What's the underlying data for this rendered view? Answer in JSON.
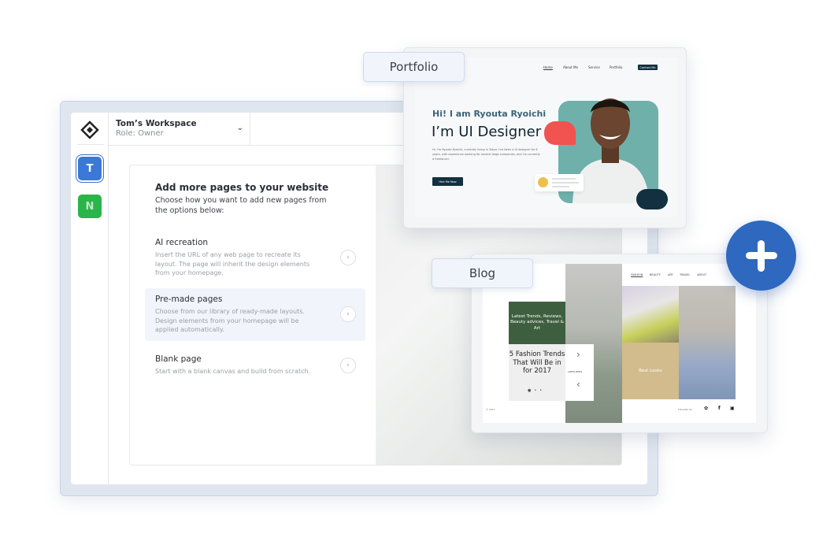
{
  "workspace": {
    "name": "Tom’s Workspace",
    "role": "Role: Owner",
    "avatars": [
      {
        "letter": "T",
        "color": "#3b78d8"
      },
      {
        "letter": "N",
        "color": "#2bb44a"
      }
    ]
  },
  "panel": {
    "title": "Add more pages to your website",
    "subtitle": "Choose how you want to add new pages from the options below:",
    "options": [
      {
        "title": "AI recreation",
        "description": "Insert the URL of any web page to recreate its layout. The page will inherit the design elements from your homepage.",
        "selected": false
      },
      {
        "title": "Pre-made pages",
        "description": "Choose from our library of ready-made layouts. Design elements from your homepage will be applied automatically.",
        "selected": true
      },
      {
        "title": "Blank page",
        "description": "Start with a blank canvas and build from scratch.",
        "selected": false
      }
    ]
  },
  "portfolio": {
    "tag": "Portfolio",
    "nav": [
      "Home",
      "About Me",
      "Service",
      "Portfolio"
    ],
    "contact": "Contact Me",
    "greeting": "Hi! I am Ryouta Ryoichi",
    "headline": "I’m UI Designer",
    "body": "Hi, I'm Ryouta Ryoichi, currently living in Tokyo. I've been a UI designer for 8 years, with experience working for several large companies, and I'm currently a freelancer.",
    "cta": "Hire Me Now"
  },
  "blog": {
    "tag": "Blog",
    "nav": [
      "FASHION",
      "BEAUTY",
      "ART",
      "TRAVEL",
      "ABOUT"
    ],
    "green_block": "Latest Trends, Reviews, Beauty advices, Travel & Art",
    "feature": "5 Fashion Trends That Will Be in for 2017",
    "latest_posts": "LATEST POSTS",
    "best_looks": "Best Looks",
    "copyright": "© 2017",
    "follow": "FOLLOW US",
    "social": [
      "twitter",
      "facebook",
      "instagram"
    ]
  },
  "fab": {
    "icon": "plus-icon",
    "color": "#2e68bf"
  }
}
